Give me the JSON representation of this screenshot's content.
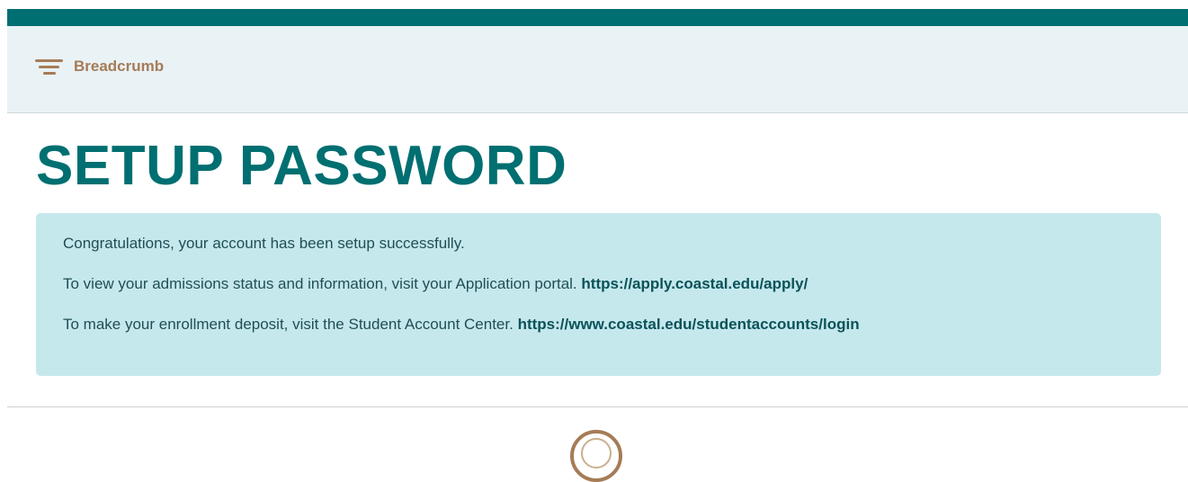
{
  "header": {
    "bar_color": "#006f71"
  },
  "breadcrumb": {
    "label": "Breadcrumb",
    "icon": "menu-lines-icon",
    "color": "#a57c57"
  },
  "page": {
    "title": "SETUP PASSWORD"
  },
  "alert": {
    "background": "#c5e8ed",
    "lines": [
      {
        "text": "Congratulations, your account has been setup successfully.",
        "link": ""
      },
      {
        "text": "To view your admissions status and information, visit your Application portal.",
        "link": "https://apply.coastal.edu/apply/"
      },
      {
        "text": "To make your enrollment deposit, visit the Student Account Center.",
        "link": "https://www.coastal.edu/studentaccounts/login"
      }
    ]
  },
  "footer": {
    "logo_icon": "university-seal-icon"
  }
}
